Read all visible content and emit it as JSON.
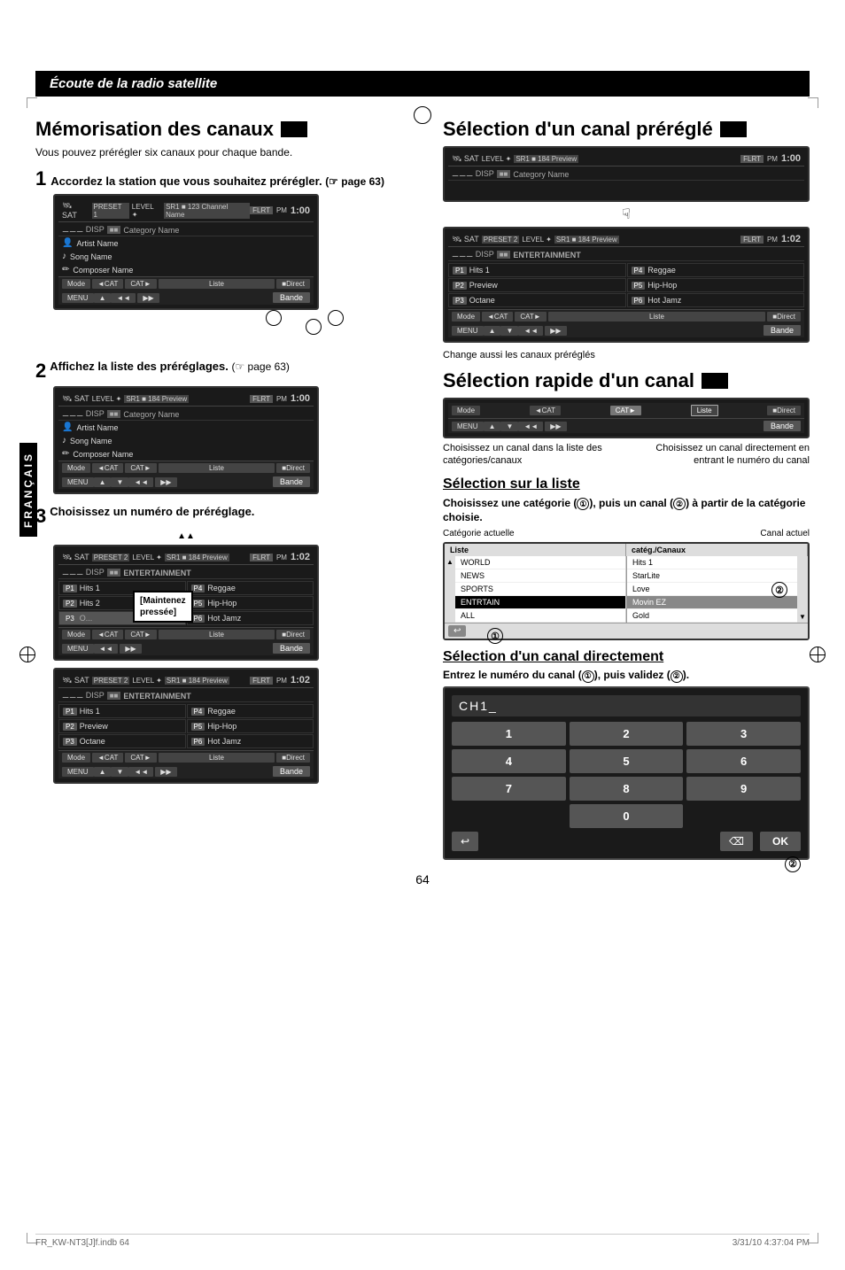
{
  "page": {
    "title": "Écoute de la radio satellite",
    "page_number": "64",
    "footer_left": "FR_KW-NT3[J]f.indb   64",
    "footer_right": "3/31/10   4:37:04 PM"
  },
  "left_section": {
    "title": "Mémorisation des canaux",
    "subtitle": "Vous pouvez prérégler six canaux pour chaque bande.",
    "step1": {
      "number": "1",
      "text": "Accordez la station que vous souhaitez prérégler.",
      "ref": "(☞ page 63)",
      "screen1": {
        "sat": "SAT",
        "preset": "PRESET 1",
        "level": "LEVEL",
        "sr1": "SR1",
        "ch": "■ 123",
        "channel_name": "Channel Name",
        "flrt": "FLRT",
        "time": "1:00",
        "disp": "DISP",
        "category": "Category Name",
        "rows": [
          "Artist Name",
          "Song Name",
          "Composer Name"
        ],
        "mode": "Mode",
        "list": "Liste",
        "direct": "■Direct",
        "bande": "Bande",
        "menu": "MENU"
      }
    },
    "step2": {
      "number": "2",
      "text": "Affichez la liste des préréglages.",
      "ref": "(☞ page 63)",
      "screen": {
        "sat": "SAT",
        "level": "LEVEL",
        "sr1": "SR1",
        "ch": "■ 184",
        "preview": "Preview",
        "flrt": "FLRT",
        "time": "1:00",
        "disp": "DISP",
        "category": "Category Name",
        "rows": [
          "Artist Name",
          "Song Name",
          "Composer Name"
        ],
        "mode": "Mode",
        "list": "Liste",
        "direct": "■Direct",
        "bande": "Bande",
        "menu": "MENU"
      }
    },
    "step3": {
      "number": "3",
      "text": "Choisissez un numéro de préréglage.",
      "callout": "[Maintenez\npressée]",
      "screen1": {
        "sat": "SAT",
        "preset": "PRESET 2",
        "level": "LEVEL",
        "sr1": "SR1",
        "ch": "■ 184",
        "preview": "Preview",
        "flrt": "FLRT",
        "time": "1:02",
        "disp": "DISP",
        "entertainment": "ENTERTAINMENT",
        "presets": [
          {
            "num": "P1",
            "name": "Hits 1"
          },
          {
            "num": "P4",
            "name": "Reggae"
          },
          {
            "num": "P2",
            "name": "Hits 2"
          },
          {
            "num": "P5",
            "name": "Hip-Hop"
          },
          {
            "num": "P3",
            "name": "O..."
          },
          {
            "num": "P6",
            "name": "Hot Jamz"
          }
        ]
      },
      "screen2": {
        "sat": "SAT",
        "preset": "PRESET 2",
        "level": "LEVEL",
        "sr1": "SR1",
        "ch": "■ 184",
        "preview": "Preview",
        "flrt": "FLRT",
        "time": "1:02",
        "disp": "DISP",
        "entertainment": "ENTERTAINMENT",
        "presets": [
          {
            "num": "P1",
            "name": "Hits 1"
          },
          {
            "num": "P4",
            "name": "Reggae"
          },
          {
            "num": "P2",
            "name": "Preview"
          },
          {
            "num": "P5",
            "name": "Hip-Hop"
          },
          {
            "num": "P3",
            "name": "Octane"
          },
          {
            "num": "P6",
            "name": "Hot Jamz"
          }
        ]
      }
    }
  },
  "right_section": {
    "title1": "Sélection d'un canal préréglé",
    "screen_top": {
      "sat": "SAT",
      "level": "LEVEL",
      "sr1": "SR1",
      "ch": "■ 184",
      "preview": "Preview",
      "flrt": "FLRT",
      "time": "1:00",
      "disp": "DISP",
      "category": "Category Name"
    },
    "screen_bottom": {
      "sat": "SAT",
      "preset": "PRESET 2",
      "level": "LEVEL",
      "sr1": "SR1",
      "ch": "■ 184",
      "preview": "Preview",
      "flrt": "FLRT",
      "time": "1:02",
      "disp": "DISP",
      "entertainment": "ENTERTAINMENT",
      "presets": [
        {
          "num": "P1",
          "name": "Hits 1"
        },
        {
          "num": "P4",
          "name": "Reggae"
        },
        {
          "num": "P2",
          "name": "Preview"
        },
        {
          "num": "P5",
          "name": "Hip-Hop"
        },
        {
          "num": "P3",
          "name": "Octane"
        },
        {
          "num": "P6",
          "name": "Hot Jamz"
        }
      ]
    },
    "note": "Change aussi les canaux préréglés",
    "title2": "Sélection rapide d'un canal",
    "mode_screen": {
      "mode": "Mode",
      "cat_left": "◄CAT",
      "cat_right": "CAT►",
      "liste": "Liste",
      "direct": "■Direct",
      "menu": "MENU",
      "arrows_up": "▲",
      "arrows_down": "▼",
      "skip_left": "◄◄",
      "skip_right": "▶▶",
      "bande": "Bande"
    },
    "mode_label1": "Choisissez un canal dans la liste des catégories/canaux",
    "mode_label2": "Choisissez un canal directement en entrant le numéro du canal",
    "title3": "Sélection sur la liste",
    "selection_desc": "Choisissez une catégorie (①), puis un canal (②) à partir de la catégorie choisie.",
    "cat_actuelle": "Catégorie actuelle",
    "canal_actuel": "Canal actuel",
    "list_screen": {
      "header": [
        "Liste",
        "catég./Canaux"
      ],
      "categories": [
        "WORLD",
        "NEWS",
        "SPORTS",
        "ENTRTAIN",
        "ALL"
      ],
      "canals": [
        "Hits 1",
        "StarLite",
        "Love",
        "Movin EZ",
        "Gold"
      ]
    },
    "title4": "Sélection d'un canal directement",
    "direct_desc": "Entrez le numéro du canal (①), puis validez (②).",
    "chi_display": "CH1_",
    "chi_keys": [
      [
        "1",
        "2",
        "3"
      ],
      [
        "4",
        "5",
        "6"
      ],
      [
        "7",
        "8",
        "9"
      ],
      [
        "",
        "0",
        ""
      ]
    ],
    "chi_back": "←",
    "chi_del": "⌫",
    "chi_ok": "OK"
  },
  "francais_label": "FRANÇAIS"
}
